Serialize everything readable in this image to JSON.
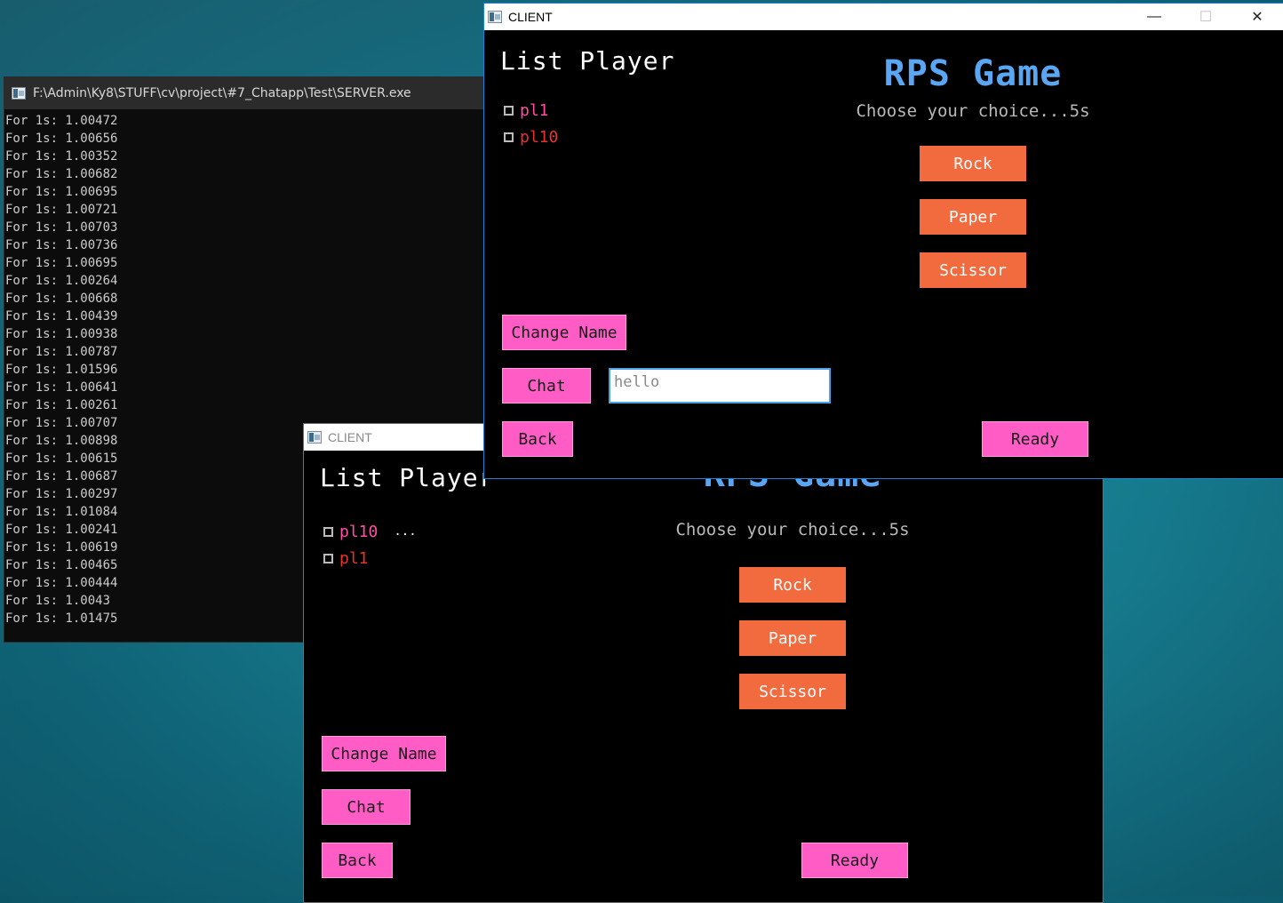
{
  "console": {
    "title": "F:\\Admin\\Ky8\\STUFF\\cv\\project\\#7_Chatapp\\Test\\SERVER.exe",
    "lines": [
      "For 1s: 1.00472",
      "For 1s: 1.00656",
      "For 1s: 1.00352",
      "For 1s: 1.00682",
      "For 1s: 1.00695",
      "For 1s: 1.00721",
      "For 1s: 1.00703",
      "For 1s: 1.00736",
      "For 1s: 1.00695",
      "For 1s: 1.00264",
      "For 1s: 1.00668",
      "For 1s: 1.00439",
      "For 1s: 1.00938",
      "For 1s: 1.00787",
      "For 1s: 1.01596",
      "For 1s: 1.00641",
      "For 1s: 1.00261",
      "For 1s: 1.00707",
      "For 1s: 1.00898",
      "For 1s: 1.00615",
      "For 1s: 1.00687",
      "For 1s: 1.00297",
      "For 1s: 1.01084",
      "For 1s: 1.00241",
      "For 1s: 1.00619",
      "For 1s: 1.00465",
      "For 1s: 1.00444",
      "For 1s: 1.0043",
      "For 1s: 1.01475"
    ]
  },
  "client_front": {
    "window_title": "CLIENT",
    "controls": {
      "minimize": "—",
      "maximize": "☐",
      "close": "✕"
    },
    "list_title": "List Player",
    "players": [
      {
        "name": "pl1",
        "color": "#ff4fa6",
        "extra": ""
      },
      {
        "name": "pl10",
        "color": "#e8332d",
        "extra": ""
      }
    ],
    "game_title": "RPS Game",
    "subtitle": "Choose your choice...5s",
    "choices": [
      "Rock",
      "Paper",
      "Scissor"
    ],
    "change_name_label": "Change Name",
    "chat_label": "Chat",
    "chat_value": "hello",
    "back_label": "Back",
    "ready_label": "Ready"
  },
  "client_back": {
    "window_title": "CLIENT",
    "list_title": "List Player",
    "players": [
      {
        "name": "pl10",
        "color": "#ff4fa6",
        "extra": "..."
      },
      {
        "name": "pl1",
        "color": "#e8332d",
        "extra": ""
      }
    ],
    "game_title": "RPS Game",
    "subtitle": "Choose your choice...5s",
    "choices": [
      "Rock",
      "Paper",
      "Scissor"
    ],
    "change_name_label": "Change Name",
    "chat_label": "Chat",
    "back_label": "Back",
    "ready_label": "Ready"
  },
  "colors": {
    "accent_blue": "#5aa6f2",
    "choice_orange": "#f26b3f",
    "button_pink": "#ff5cc6",
    "player_pink": "#ff4fa6",
    "player_red": "#e8332d"
  }
}
